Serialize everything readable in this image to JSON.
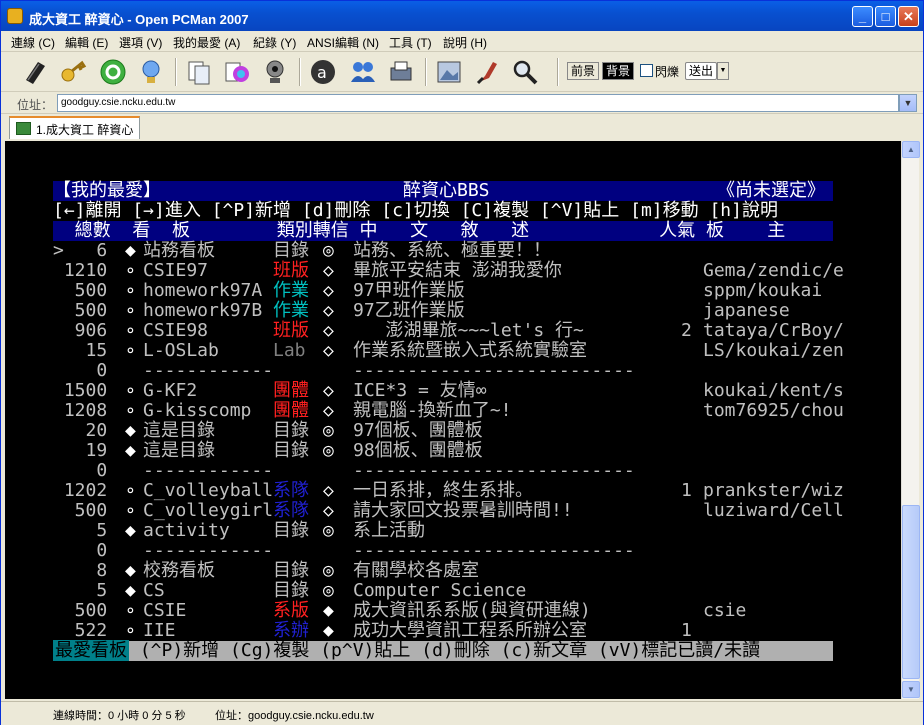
{
  "window": {
    "title": "成大資工 醉資心 - Open PCMan 2007"
  },
  "menu": [
    "連線 (C)",
    "編輯 (E)",
    "選項 (V)",
    "我的最愛 (A)",
    "紀錄 (Y)",
    "ANSI編輯 (N)",
    "工具 (T)",
    "說明 (H)"
  ],
  "toolbar": {
    "icons": [
      "connect-book-icon",
      "key-icon",
      "refresh-icon",
      "bulb-icon",
      "copy-icon",
      "color-icon",
      "webcam-icon",
      "ansi-a-icon",
      "users-icon",
      "print-icon",
      "picture-icon",
      "brush-icon",
      "magnifier-icon"
    ],
    "fg_label": "前景",
    "bg_label": "背景",
    "blink_label": "閃爍",
    "send_label": "送出"
  },
  "address": {
    "label": "位址：",
    "value": "goodguy.csie.ncku.edu.tw"
  },
  "tab": {
    "label": "1.成大資工 醉資心"
  },
  "term": {
    "title_left": "【我的最愛】",
    "title_center": "醉資心BBS",
    "title_right": "《尚未選定》",
    "help_line": "[←]離開 [→]進入 [^P]新增 [d]刪除 [c]切換 [C]複製 [^V]貼上 [m]移動 [h]說明",
    "col_header": "  總數  看  板        類別轉信 中   文   敘   述            人氣 板    主",
    "rows": [
      {
        "num": ">   6",
        "mark": "◆",
        "board": "站務看板",
        "cat": "目錄",
        "catc": "c-gray",
        "sym": "◎",
        "desc": "站務、系統、極重要！！",
        "pop": "",
        "bm": ""
      },
      {
        "num": " 1210",
        "mark": "∘",
        "board": "CSIE97",
        "cat": "班版",
        "catc": "c-red",
        "sym": "◇",
        "desc": "畢旅平安結束 澎湖我愛你",
        "pop": "",
        "bm": "Gema/zendic/e"
      },
      {
        "num": "  500",
        "mark": "∘",
        "board": "homework97A",
        "cat": "作業",
        "catc": "c-cyan",
        "sym": "◇",
        "desc": "97甲班作業版",
        "pop": "",
        "bm": "sppm/koukai"
      },
      {
        "num": "  500",
        "mark": "∘",
        "board": "homework97B",
        "cat": "作業",
        "catc": "c-cyan",
        "sym": "◇",
        "desc": "97乙班作業版",
        "pop": "",
        "bm": "japanese"
      },
      {
        "num": "  906",
        "mark": "∘",
        "board": "CSIE98",
        "cat": "班版",
        "catc": "c-red",
        "sym": "◇",
        "desc": "   澎湖畢旅~~~let's 行~",
        "pop": "2",
        "bm": "tataya/CrBoy/"
      },
      {
        "num": "   15",
        "mark": "∘",
        "board": "L-OSLab",
        "cat": "Lab",
        "catc": "c-dim",
        "sym": "◇",
        "desc": "作業系統暨嵌入式系統實驗室",
        "pop": "",
        "bm": "LS/koukai/zen"
      },
      {
        "num": "    0",
        "mark": " ",
        "board": "------------",
        "cat": "",
        "catc": "c-gray",
        "sym": "",
        "desc": "--------------------------",
        "pop": "",
        "bm": ""
      },
      {
        "num": " 1500",
        "mark": "∘",
        "board": "G-KF2",
        "cat": "團體",
        "catc": "c-red",
        "sym": "◇",
        "desc": "ICE*3 = 友情∞",
        "pop": "",
        "bm": "koukai/kent/s"
      },
      {
        "num": " 1208",
        "mark": "∘",
        "board": "G-kisscomp",
        "cat": "團體",
        "catc": "c-red",
        "sym": "◇",
        "desc": "親電腦-換新血了~!",
        "pop": "",
        "bm": "tom76925/chou"
      },
      {
        "num": "   20",
        "mark": "◆",
        "board": "這是目錄",
        "cat": "目錄",
        "catc": "c-gray",
        "sym": "◎",
        "desc": "97個板、團體板",
        "pop": "",
        "bm": ""
      },
      {
        "num": "   19",
        "mark": "◆",
        "board": "這是目錄",
        "cat": "目錄",
        "catc": "c-gray",
        "sym": "◎",
        "desc": "98個板、團體板",
        "pop": "",
        "bm": ""
      },
      {
        "num": "    0",
        "mark": " ",
        "board": "------------",
        "cat": "",
        "catc": "c-gray",
        "sym": "",
        "desc": "--------------------------",
        "pop": "",
        "bm": ""
      },
      {
        "num": " 1202",
        "mark": "∘",
        "board": "C_volleyball",
        "cat": "系隊",
        "catc": "c-blue",
        "sym": "◇",
        "desc": "一日系排，終生系排。",
        "pop": "1",
        "bm": "prankster/wiz"
      },
      {
        "num": "  500",
        "mark": "∘",
        "board": "C_volleygirl",
        "cat": "系隊",
        "catc": "c-blue",
        "sym": "◇",
        "desc": "請大家回文投票暑訓時間!!",
        "pop": "",
        "bm": "luziward/Cell"
      },
      {
        "num": "    5",
        "mark": "◆",
        "board": "activity",
        "cat": "目錄",
        "catc": "c-gray",
        "sym": "◎",
        "desc": "系上活動",
        "pop": "",
        "bm": ""
      },
      {
        "num": "    0",
        "mark": " ",
        "board": "------------",
        "cat": "",
        "catc": "c-gray",
        "sym": "",
        "desc": "--------------------------",
        "pop": "",
        "bm": ""
      },
      {
        "num": "    8",
        "mark": "◆",
        "board": "校務看板",
        "cat": "目錄",
        "catc": "c-gray",
        "sym": "◎",
        "desc": "有關學校各處室",
        "pop": "",
        "bm": ""
      },
      {
        "num": "    5",
        "mark": "◆",
        "board": "CS",
        "cat": "目錄",
        "catc": "c-gray",
        "sym": "◎",
        "desc": "Computer Science",
        "pop": "",
        "bm": ""
      },
      {
        "num": "  500",
        "mark": "∘",
        "board": "CSIE",
        "cat": "系版",
        "catc": "c-red",
        "sym": "◆",
        "desc": "成大資訊系系版(與資研連線)",
        "pop": "",
        "bm": "csie"
      },
      {
        "num": "  522",
        "mark": "∘",
        "board": "IIE",
        "cat": "系辦",
        "catc": "c-blue",
        "sym": "◆",
        "desc": "成功大學資訊工程系所辦公室",
        "pop": "1",
        "bm": ""
      }
    ],
    "footer_tag": "最愛看板",
    "footer_help": " (^P)新增 (Cg)複製 (p^V)貼上 (d)刪除 (c)新文章 (vV)標記已讀/未讀"
  },
  "status": {
    "conn_time": "連線時間：0 小時 0 分 5 秒",
    "address": "位址：goodguy.csie.ncku.edu.tw"
  }
}
